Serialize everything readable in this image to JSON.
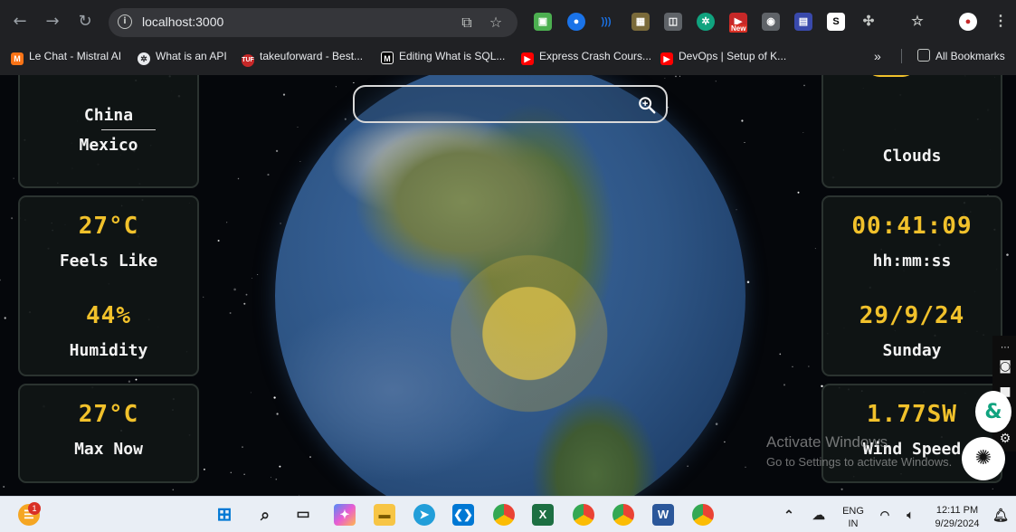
{
  "browser": {
    "url": "localhost:3000",
    "ext_badge": "New",
    "bookmarks": [
      {
        "label": "Le Chat - Mistral AI",
        "icon": "mistral-icon",
        "color": "#f97316"
      },
      {
        "label": "What is an API",
        "icon": "openai-icon",
        "color": "#e8eaed"
      },
      {
        "label": "takeuforward - Best...",
        "icon": "tuf-icon",
        "color": "#c62828"
      },
      {
        "label": "Editing What is SQL...",
        "icon": "medium-icon",
        "color": "#000000"
      },
      {
        "label": "Express Crash Cours...",
        "icon": "youtube-icon",
        "color": "#ff0000"
      },
      {
        "label": "DevOps | Setup of K...",
        "icon": "youtube-icon",
        "color": "#ff0000"
      }
    ],
    "all_bookmarks": "All Bookmarks"
  },
  "search": {
    "placeholder": ""
  },
  "left": {
    "countries": [
      "China",
      "Mexico"
    ],
    "feels_like": {
      "value": "27°C",
      "label": "Feels Like"
    },
    "humidity": {
      "value": "44%",
      "label": "Humidity"
    },
    "max_now": {
      "value": "27°C",
      "label": "Max Now"
    }
  },
  "right": {
    "condition": "Clouds",
    "time": {
      "value": "00:41:09",
      "label": "hh:mm:ss"
    },
    "date": {
      "value": "29/9/24",
      "label": "Sunday"
    },
    "wind": {
      "value": "1.77SW",
      "label": "Wind Speed"
    }
  },
  "watermark": {
    "line1": "Activate Windows",
    "line2": "Go to Settings to activate Windows."
  },
  "taskbar": {
    "lang": "ENG",
    "region": "IN",
    "time": "12:11 PM",
    "date": "9/29/2024",
    "notification_count": "1"
  },
  "colors": {
    "accent": "#f1c12b",
    "card_border": "#2b3330",
    "browser_bg": "#202124"
  }
}
